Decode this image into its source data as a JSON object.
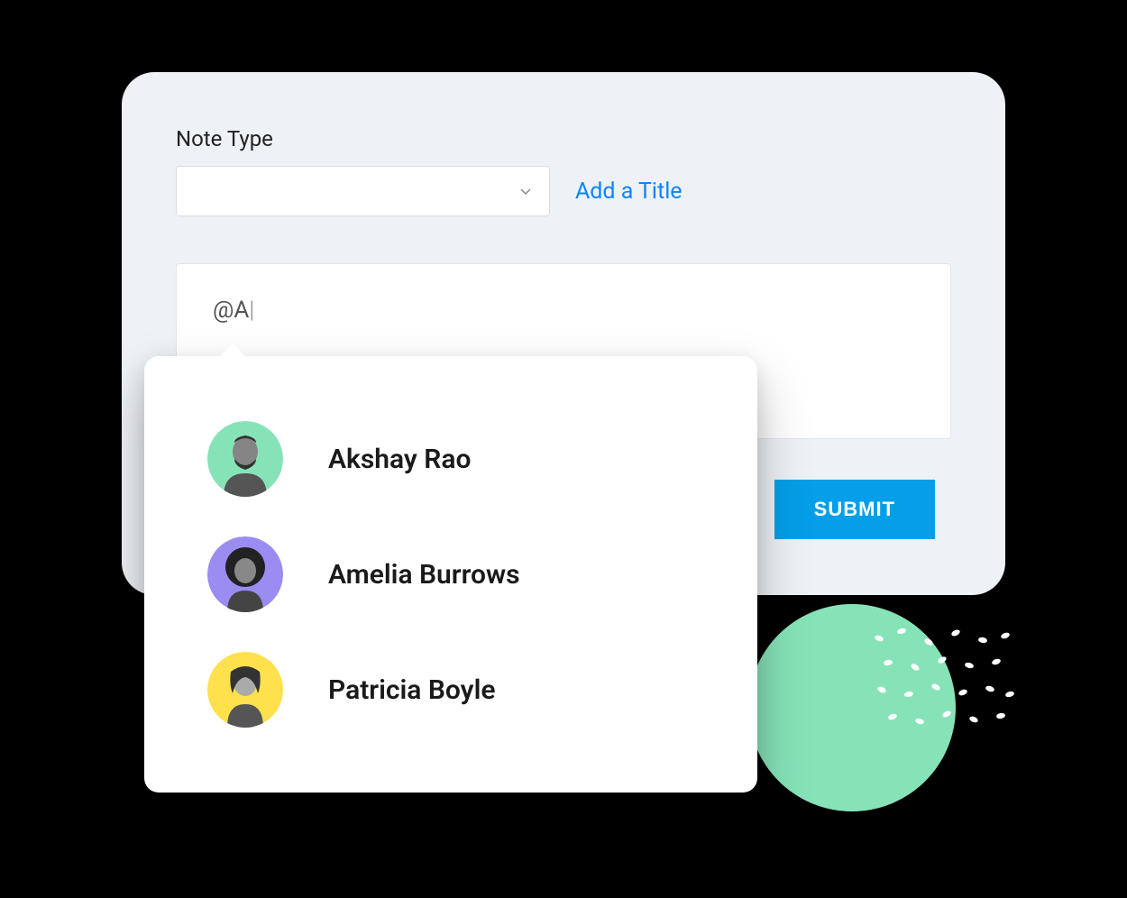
{
  "form": {
    "note_type_label": "Note Type",
    "add_title_link": "Add a Title",
    "body_value": "@A",
    "submit_label": "SUBMIT"
  },
  "mention_popover": {
    "suggestions": [
      {
        "name": "Akshay Rao",
        "avatar_bg": "#86e3b8"
      },
      {
        "name": "Amelia Burrows",
        "avatar_bg": "#9a8cf0"
      },
      {
        "name": "Patricia Boyle",
        "avatar_bg": "#ffe04d"
      }
    ]
  },
  "colors": {
    "accent_blue": "#0a84ff",
    "submit_blue": "#049fe8",
    "card_bg": "#eef1f5"
  }
}
